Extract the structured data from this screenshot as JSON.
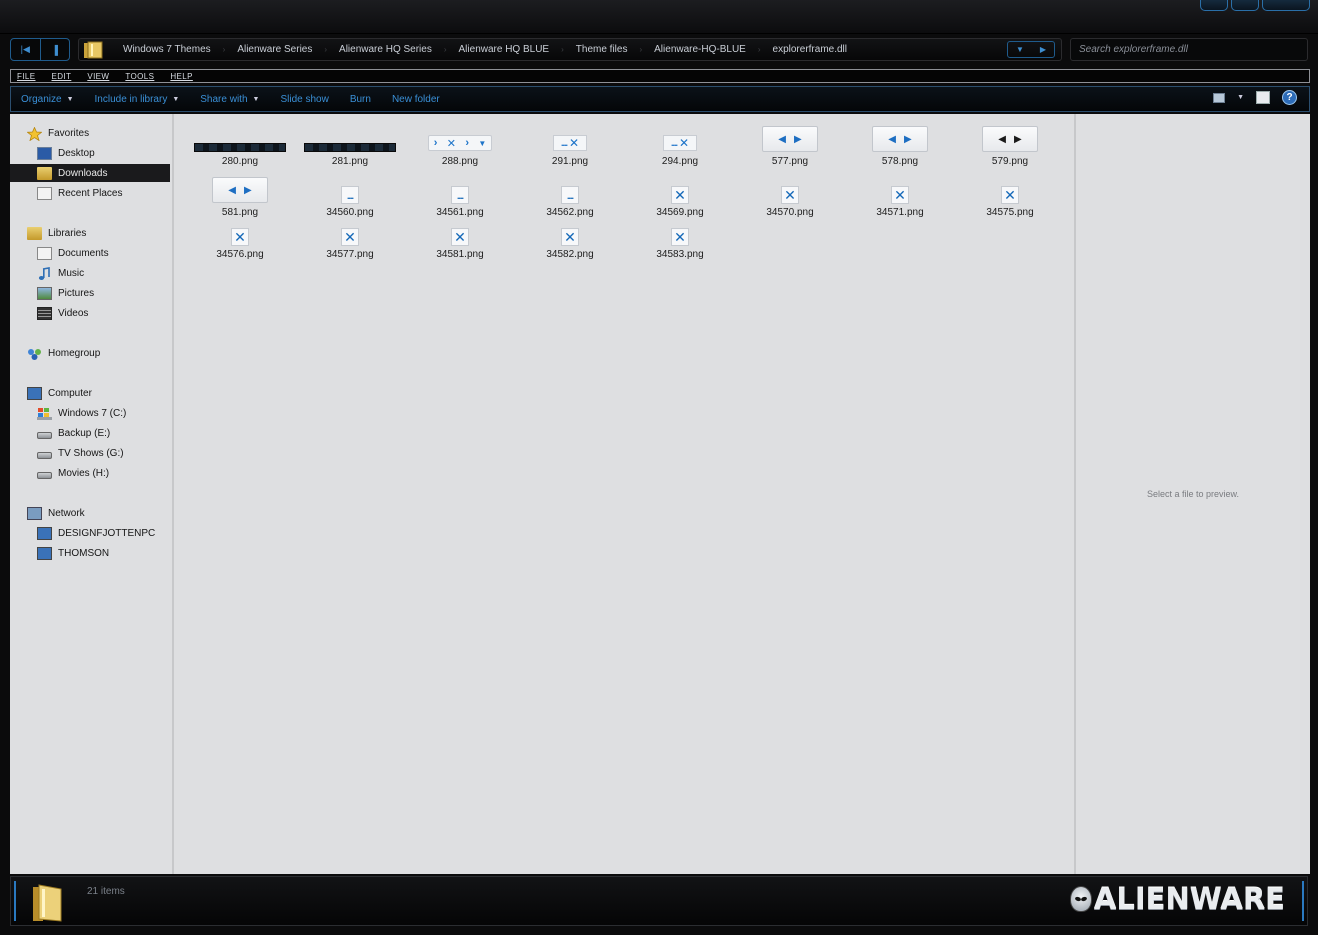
{
  "window": {
    "caption_buttons": [
      "minimize",
      "maximize",
      "close"
    ]
  },
  "address": {
    "breadcrumbs": [
      "Windows 7 Themes",
      "Alienware Series",
      "Alienware HQ Series",
      "Alienware HQ BLUE",
      "Theme files",
      "Alienware-HQ-BLUE",
      "explorerframe.dll"
    ]
  },
  "search": {
    "placeholder": "Search explorerframe.dll"
  },
  "menu": {
    "items": [
      "FILE",
      "EDIT",
      "VIEW",
      "TOOLS",
      "HELP"
    ]
  },
  "toolbar": {
    "organize": "Organize",
    "include": "Include in library",
    "share": "Share with",
    "slideshow": "Slide show",
    "burn": "Burn",
    "new_folder": "New folder",
    "help": "?"
  },
  "nav": {
    "favorites": "Favorites",
    "desktop": "Desktop",
    "downloads": "Downloads",
    "recent": "Recent Places",
    "libraries": "Libraries",
    "documents": "Documents",
    "music": "Music",
    "pictures": "Pictures",
    "videos": "Videos",
    "homegroup": "Homegroup",
    "computer": "Computer",
    "drive_c": "Windows 7 (C:)",
    "drive_e": "Backup (E:)",
    "drive_g": "TV Shows (G:)",
    "drive_h": "Movies (H:)",
    "network": "Network",
    "pc1": "DESIGNFJOTTENPC",
    "pc2": "THOMSON"
  },
  "files": [
    "280.png",
    "281.png",
    "288.png",
    "291.png",
    "294.png",
    "577.png",
    "578.png",
    "579.png",
    "581.png",
    "34560.png",
    "34561.png",
    "34562.png",
    "34569.png",
    "34570.png",
    "34571.png",
    "34575.png",
    "34576.png",
    "34577.png",
    "34581.png",
    "34582.png",
    "34583.png"
  ],
  "preview": {
    "message": "Select a file to preview."
  },
  "status": {
    "item_count": "21 items",
    "brand": "ALIENWARE"
  },
  "colors": {
    "accent": "#3a8fd6",
    "chrome": "#0b0b0c",
    "content_bg": "#dedfe1"
  }
}
